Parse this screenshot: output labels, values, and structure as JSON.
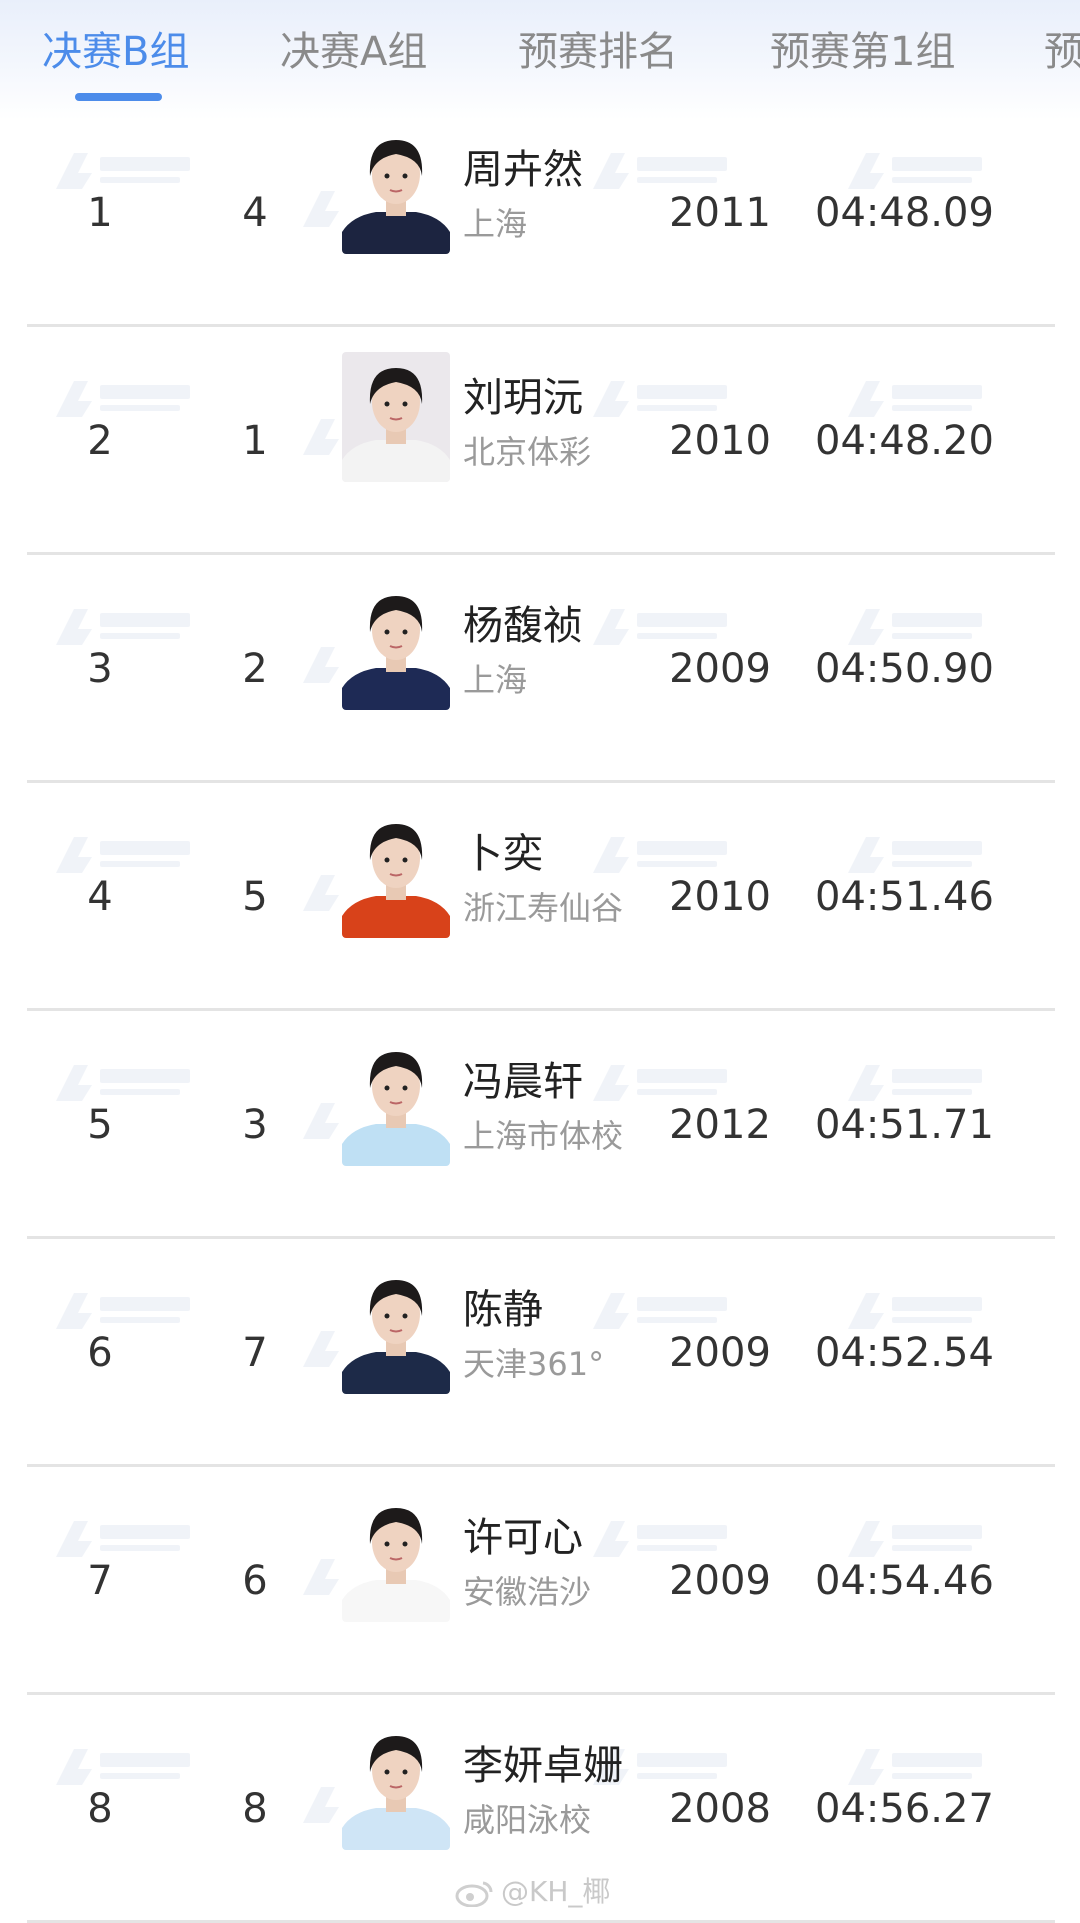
{
  "tabs": [
    {
      "label": "决赛B组",
      "active": true
    },
    {
      "label": "决赛A组",
      "active": false
    },
    {
      "label": "预赛排名",
      "active": false
    },
    {
      "label": "预赛第1组",
      "active": false
    },
    {
      "label": "预",
      "active": false
    }
  ],
  "rows": [
    {
      "rank": "1",
      "lane": "4",
      "name": "周卉然",
      "team": "上海",
      "year": "2011",
      "time": "04:48.09"
    },
    {
      "rank": "2",
      "lane": "1",
      "name": "刘玥沅",
      "team": "北京体彩",
      "year": "2010",
      "time": "04:48.20"
    },
    {
      "rank": "3",
      "lane": "2",
      "name": "杨馥祯",
      "team": "上海",
      "year": "2009",
      "time": "04:50.90"
    },
    {
      "rank": "4",
      "lane": "5",
      "name": "卜奕",
      "team": "浙江寿仙谷",
      "year": "2010",
      "time": "04:51.46"
    },
    {
      "rank": "5",
      "lane": "3",
      "name": "冯晨轩",
      "team": "上海市体校",
      "year": "2012",
      "time": "04:51.71"
    },
    {
      "rank": "6",
      "lane": "7",
      "name": "陈静",
      "team": "天津361°",
      "year": "2009",
      "time": "04:52.54"
    },
    {
      "rank": "7",
      "lane": "6",
      "name": "许可心",
      "team": "安徽浩沙",
      "year": "2009",
      "time": "04:54.46"
    },
    {
      "rank": "8",
      "lane": "8",
      "name": "李妍卓姗",
      "team": "咸阳泳校",
      "year": "2008",
      "time": "04:56.27"
    }
  ],
  "watermark_credit": "@KH_椰",
  "colors": {
    "accent": "#4c8cea",
    "divider": "#e4e4e4",
    "muted": "#9a9a9a"
  },
  "icons": {
    "photo": "athlete-photo-icon",
    "watermark": "weibo-icon"
  }
}
